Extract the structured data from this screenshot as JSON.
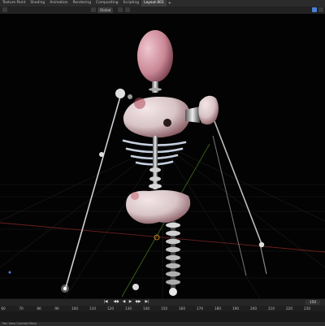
{
  "tabs": [
    "Texture Paint",
    "Shading",
    "Animation",
    "Rendering",
    "Compositing",
    "Scripting",
    "Layout.001"
  ],
  "active_tab": "Layout.001",
  "add_tab": "+",
  "header": {
    "orientation_label": "Global",
    "orientation_icon": "orientation-icon"
  },
  "viewport": {
    "description_icon": "viewport-shading-icon"
  },
  "timeline": {
    "ruler_labels": [
      "60",
      "70",
      "80",
      "90",
      "100",
      "110",
      "120",
      "130",
      "140",
      "150",
      "160",
      "170",
      "180",
      "190",
      "200",
      "210",
      "220",
      "230"
    ],
    "current_frame": "150",
    "controls": {
      "jump_start": "|◀",
      "prev_key": "◀◆",
      "play_reverse": "◀",
      "play": "▶",
      "next_key": "◆▶",
      "jump_end": "▶|"
    }
  },
  "statusbar": {
    "text": "Pan View   Context Menu"
  },
  "colors": {
    "accent": "#4a7fd6",
    "active_tab_bg": "#3d3d3d",
    "grid": "#1e1e1e",
    "x_axis": "#7a2222",
    "y_axis": "#3a6a1a"
  }
}
